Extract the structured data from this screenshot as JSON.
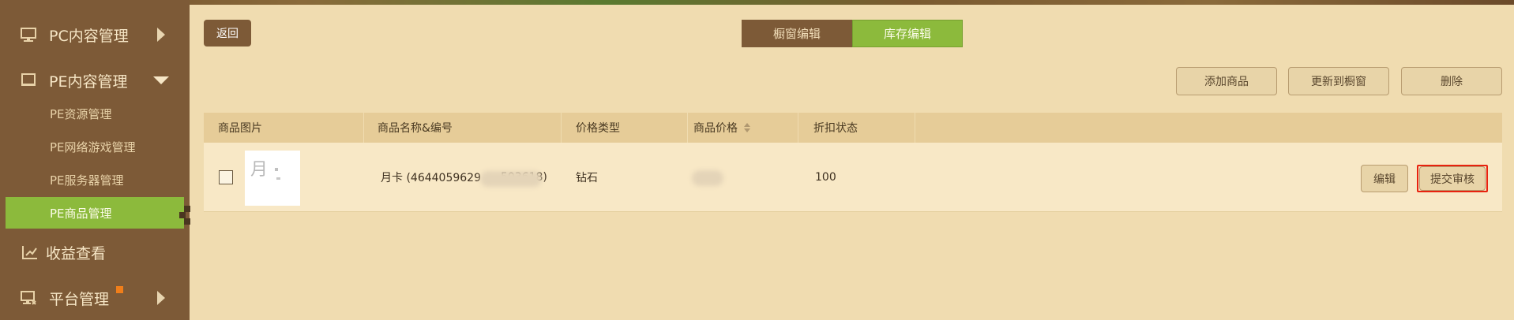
{
  "sidebar": {
    "items": [
      {
        "label": "PC内容管理"
      },
      {
        "label": "PE内容管理"
      },
      {
        "label": "收益查看"
      },
      {
        "label": "平台管理"
      }
    ],
    "sub_items": [
      {
        "label": "PE资源管理"
      },
      {
        "label": "PE网络游戏管理"
      },
      {
        "label": "PE服务器管理"
      },
      {
        "label": "PE商品管理"
      }
    ]
  },
  "toolbar": {
    "back_label": "返回",
    "tabs": [
      {
        "label": "橱窗编辑"
      },
      {
        "label": "库存编辑"
      }
    ],
    "actions": [
      {
        "label": "添加商品"
      },
      {
        "label": "更新到橱窗"
      },
      {
        "label": "删除"
      }
    ]
  },
  "table": {
    "headers": [
      "商品图片",
      "商品名称&编号",
      "价格类型",
      "商品价格",
      "折扣状态"
    ],
    "rows": [
      {
        "thumb_text": "月",
        "name_prefix": "月卡 (4644059629",
        "name_suffix": "503618)",
        "price_type": "钻石",
        "discount": "100",
        "edit_label": "编辑",
        "submit_label": "提交审核"
      }
    ]
  },
  "colors": {
    "sidebar_bg": "#7d5a37",
    "page_bg": "#f0dcb0",
    "accent_green": "#8cba3c",
    "highlight_red": "#e8220e"
  }
}
